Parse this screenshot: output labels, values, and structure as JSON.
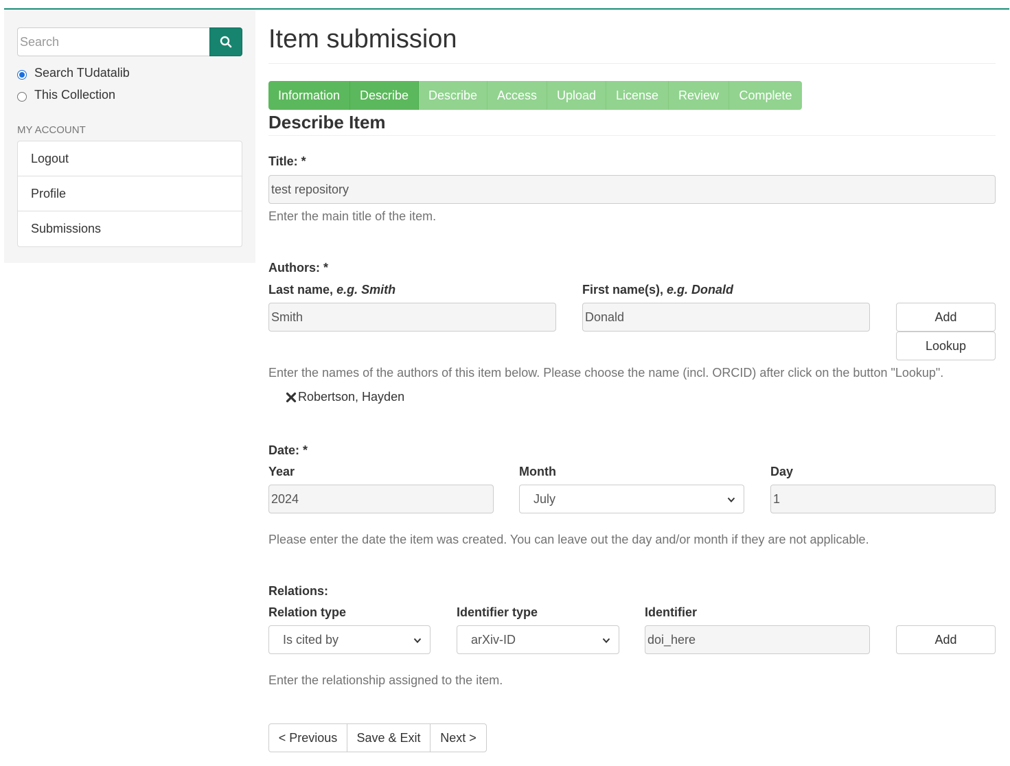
{
  "sidebar": {
    "search": {
      "placeholder": "Search"
    },
    "scope_options": [
      {
        "label": "Search TUdatalib",
        "checked": true
      },
      {
        "label": "This Collection",
        "checked": false
      }
    ],
    "account_heading": "MY ACCOUNT",
    "account_items": [
      "Logout",
      "Profile",
      "Submissions"
    ]
  },
  "main": {
    "page_title": "Item submission",
    "steps": [
      {
        "label": "Information",
        "state": "done"
      },
      {
        "label": "Describe",
        "state": "current"
      },
      {
        "label": "Describe",
        "state": "todo"
      },
      {
        "label": "Access",
        "state": "todo"
      },
      {
        "label": "Upload",
        "state": "todo"
      },
      {
        "label": "License",
        "state": "todo"
      },
      {
        "label": "Review",
        "state": "todo"
      },
      {
        "label": "Complete",
        "state": "todo"
      }
    ],
    "section_title": "Describe Item",
    "title_field": {
      "label": "Title: *",
      "value": "test repository",
      "help": "Enter the main title of the item."
    },
    "authors": {
      "label": "Authors: *",
      "last_label": "Last name,",
      "last_example": "e.g. Smith",
      "first_label": "First name(s),",
      "first_example": "e.g. Donald",
      "last_value": "Smith",
      "first_value": "Donald",
      "add_label": "Add",
      "lookup_label": "Lookup",
      "help": "Enter the names of the authors of this item below. Please choose the name (incl. ORCID) after click on the button \"Lookup\".",
      "entries": [
        "Robertson, Hayden"
      ]
    },
    "date": {
      "label": "Date: *",
      "year_label": "Year",
      "month_label": "Month",
      "day_label": "Day",
      "year_value": "2024",
      "month_value": "July",
      "day_value": "1",
      "help": "Please enter the date the item was created. You can leave out the day and/or month if they are not applicable."
    },
    "relations": {
      "label": "Relations:",
      "type_label": "Relation type",
      "id_type_label": "Identifier type",
      "id_label": "Identifier",
      "type_value": "Is cited by",
      "id_type_value": "arXiv-ID",
      "id_value": "doi_here",
      "add_label": "Add",
      "help": "Enter the relationship assigned to the item."
    },
    "nav": {
      "previous": "< Previous",
      "save_exit": "Save & Exit",
      "next": "Next >"
    }
  },
  "colors": {
    "accent_teal": "#17846f",
    "step_done": "#5cb85c",
    "step_todo": "#91d38f"
  }
}
